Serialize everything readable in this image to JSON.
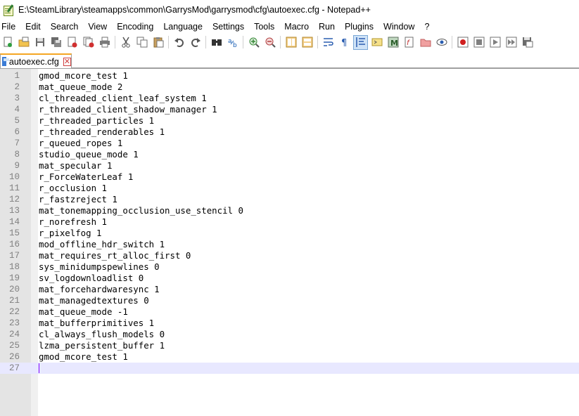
{
  "window": {
    "title": "E:\\SteamLibrary\\steamapps\\common\\GarrysMod\\garrysmod\\cfg\\autoexec.cfg - Notepad++"
  },
  "menu": [
    "File",
    "Edit",
    "Search",
    "View",
    "Encoding",
    "Language",
    "Settings",
    "Tools",
    "Macro",
    "Run",
    "Plugins",
    "Window",
    "?"
  ],
  "toolbar": {
    "groups": [
      [
        "new-file-icon",
        "open-file-icon",
        "save-icon",
        "save-all-icon",
        "close-icon",
        "close-all-icon",
        "print-icon"
      ],
      [
        "cut-icon",
        "copy-icon",
        "paste-icon"
      ],
      [
        "undo-icon",
        "redo-icon"
      ],
      [
        "find-icon",
        "replace-icon"
      ],
      [
        "zoom-in-icon",
        "zoom-out-icon"
      ],
      [
        "sync-vertical-icon",
        "sync-horizontal-icon"
      ],
      [
        "word-wrap-icon",
        "show-all-chars-icon",
        "indent-guide-icon",
        "user-defined-lang-icon",
        "doc-map-icon",
        "function-list-icon",
        "folder-workspace-icon",
        "monitoring-icon"
      ],
      [
        "record-macro-icon",
        "stop-macro-icon",
        "play-macro-icon",
        "run-macro-multiple-icon",
        "save-macro-icon"
      ]
    ],
    "active": "indent-guide-icon"
  },
  "tabs": [
    {
      "label": "autoexec.cfg",
      "active": true
    }
  ],
  "editor": {
    "current_line": 27,
    "lines": [
      "gmod_mcore_test 1",
      "mat_queue_mode 2",
      "cl_threaded_client_leaf_system 1",
      "r_threaded_client_shadow_manager 1",
      "r_threaded_particles 1",
      "r_threaded_renderables 1",
      "r_queued_ropes 1",
      "studio_queue_mode 1",
      "mat_specular 1",
      "r_ForceWaterLeaf 1",
      "r_occlusion 1",
      "r_fastzreject 1",
      "mat_tonemapping_occlusion_use_stencil 0",
      "r_norefresh 1",
      "r_pixelfog 1",
      "mod_offline_hdr_switch 1",
      "mat_requires_rt_alloc_first 0",
      "sys_minidumpspewlines 0",
      "sv_logdownloadlist 0",
      "mat_forcehardwaresync 1",
      "mat_managedtextures 0",
      "mat_queue_mode -1",
      "mat_bufferprimitives 1",
      "cl_always_flush_models 0",
      "lzma_persistent_buffer 1",
      "gmod_mcore_test 1",
      ""
    ]
  }
}
